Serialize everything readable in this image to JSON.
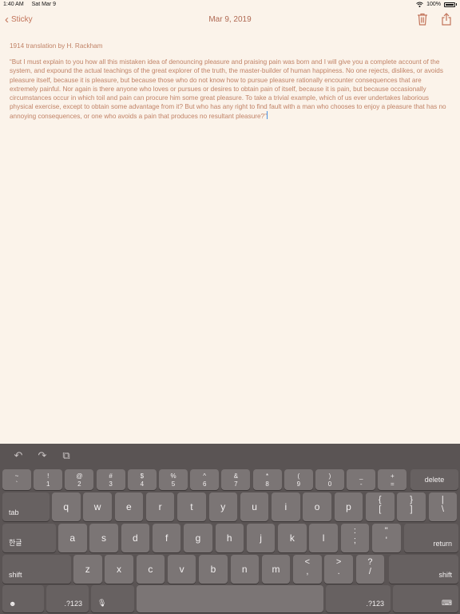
{
  "status": {
    "time": "1:40 AM",
    "date": "Sat Mar 9",
    "battery": "100%"
  },
  "nav": {
    "back_label": "Sticky",
    "title": "Mar 9, 2019",
    "accent": "#c2745a"
  },
  "note": {
    "subtitle": "1914 translation by H. Rackham",
    "body": "“But I must explain to you how all this mistaken idea of denouncing pleasure and praising pain was born and I will give you a complete account of the system, and expound the actual teachings of the great explorer of the truth, the master-builder of human happiness. No one rejects, dislikes, or avoids pleasure itself, because it is pleasure, but because those who do not know how to pursue pleasure rationally encounter consequences that are extremely painful. Nor again is there anyone who loves or pursues or desires to obtain pain of itself, because it is pain, but because occasionally circumstances occur in which toil and pain can procure him some great pleasure. To take a trivial example, which of us ever undertakes laborious physical exercise, except to obtain some advantage from it? But who has any right to find fault with a man who chooses to enjoy a pleasure that has no annoying consequences, or one who avoids a pain that produces no resultant pleasure?”"
  },
  "keyboard": {
    "number_row": [
      {
        "top": "~",
        "bottom": "`"
      },
      {
        "top": "!",
        "bottom": "1"
      },
      {
        "top": "@",
        "bottom": "2"
      },
      {
        "top": "#",
        "bottom": "3"
      },
      {
        "top": "$",
        "bottom": "4"
      },
      {
        "top": "%",
        "bottom": "5"
      },
      {
        "top": "^",
        "bottom": "6"
      },
      {
        "top": "&",
        "bottom": "7"
      },
      {
        "top": "*",
        "bottom": "8"
      },
      {
        "top": "(",
        "bottom": "9"
      },
      {
        "top": ")",
        "bottom": "0"
      },
      {
        "top": "_",
        "bottom": "-"
      },
      {
        "top": "+",
        "bottom": "="
      }
    ],
    "delete_label": "delete",
    "tab_label": "tab",
    "row_q": [
      "q",
      "w",
      "e",
      "r",
      "t",
      "y",
      "u",
      "i",
      "o",
      "p"
    ],
    "row_q_punct": [
      {
        "top": "{",
        "bottom": "["
      },
      {
        "top": "}",
        "bottom": "]"
      },
      {
        "top": "|",
        "bottom": "\\"
      }
    ],
    "lang_label": "한글",
    "row_a": [
      "a",
      "s",
      "d",
      "f",
      "g",
      "h",
      "j",
      "k",
      "l"
    ],
    "row_a_punct": [
      {
        "top": ":",
        "bottom": ";"
      },
      {
        "top": "\"",
        "bottom": "'"
      }
    ],
    "return_label": "return",
    "shift_label": "shift",
    "row_z": [
      "z",
      "x",
      "c",
      "v",
      "b",
      "n",
      "m"
    ],
    "row_z_punct": [
      {
        "top": "<",
        "bottom": ","
      },
      {
        "top": ">",
        "bottom": "."
      },
      {
        "top": "?",
        "bottom": "/"
      }
    ],
    "numbers_label": ".?123"
  }
}
